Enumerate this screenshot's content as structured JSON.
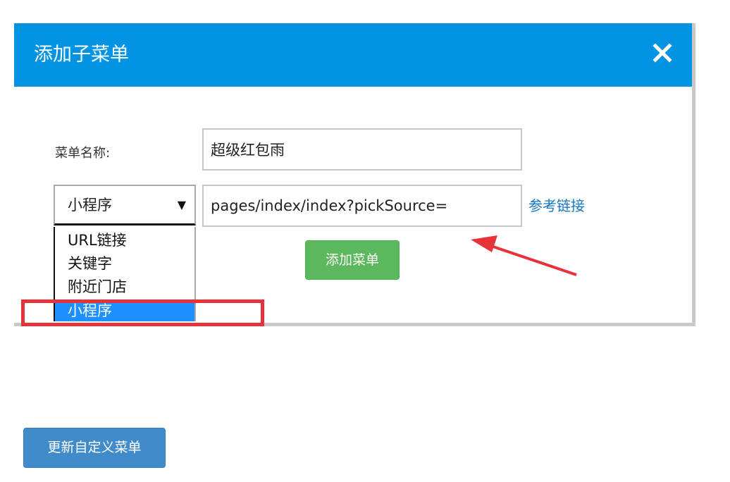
{
  "dialog": {
    "title": "添加子菜单",
    "close_icon": "close-icon"
  },
  "form": {
    "name_label": "菜单名称:",
    "name_value": "超级红包雨",
    "type_select": {
      "selected": "小程序",
      "arrow": "▼",
      "options": [
        "URL链接",
        "关键字",
        "附近门店",
        "小程序"
      ]
    },
    "url_value": "pages/index/index?pickSource=",
    "reference_link": "参考链接",
    "add_button": "添加菜单"
  },
  "footer": {
    "update_button": "更新自定义菜单"
  },
  "colors": {
    "header": "#0294e2",
    "add_button": "#5cb85c",
    "update_button": "#428bca",
    "annotation": "#e8323a",
    "selected_option": "#1e90ff"
  }
}
